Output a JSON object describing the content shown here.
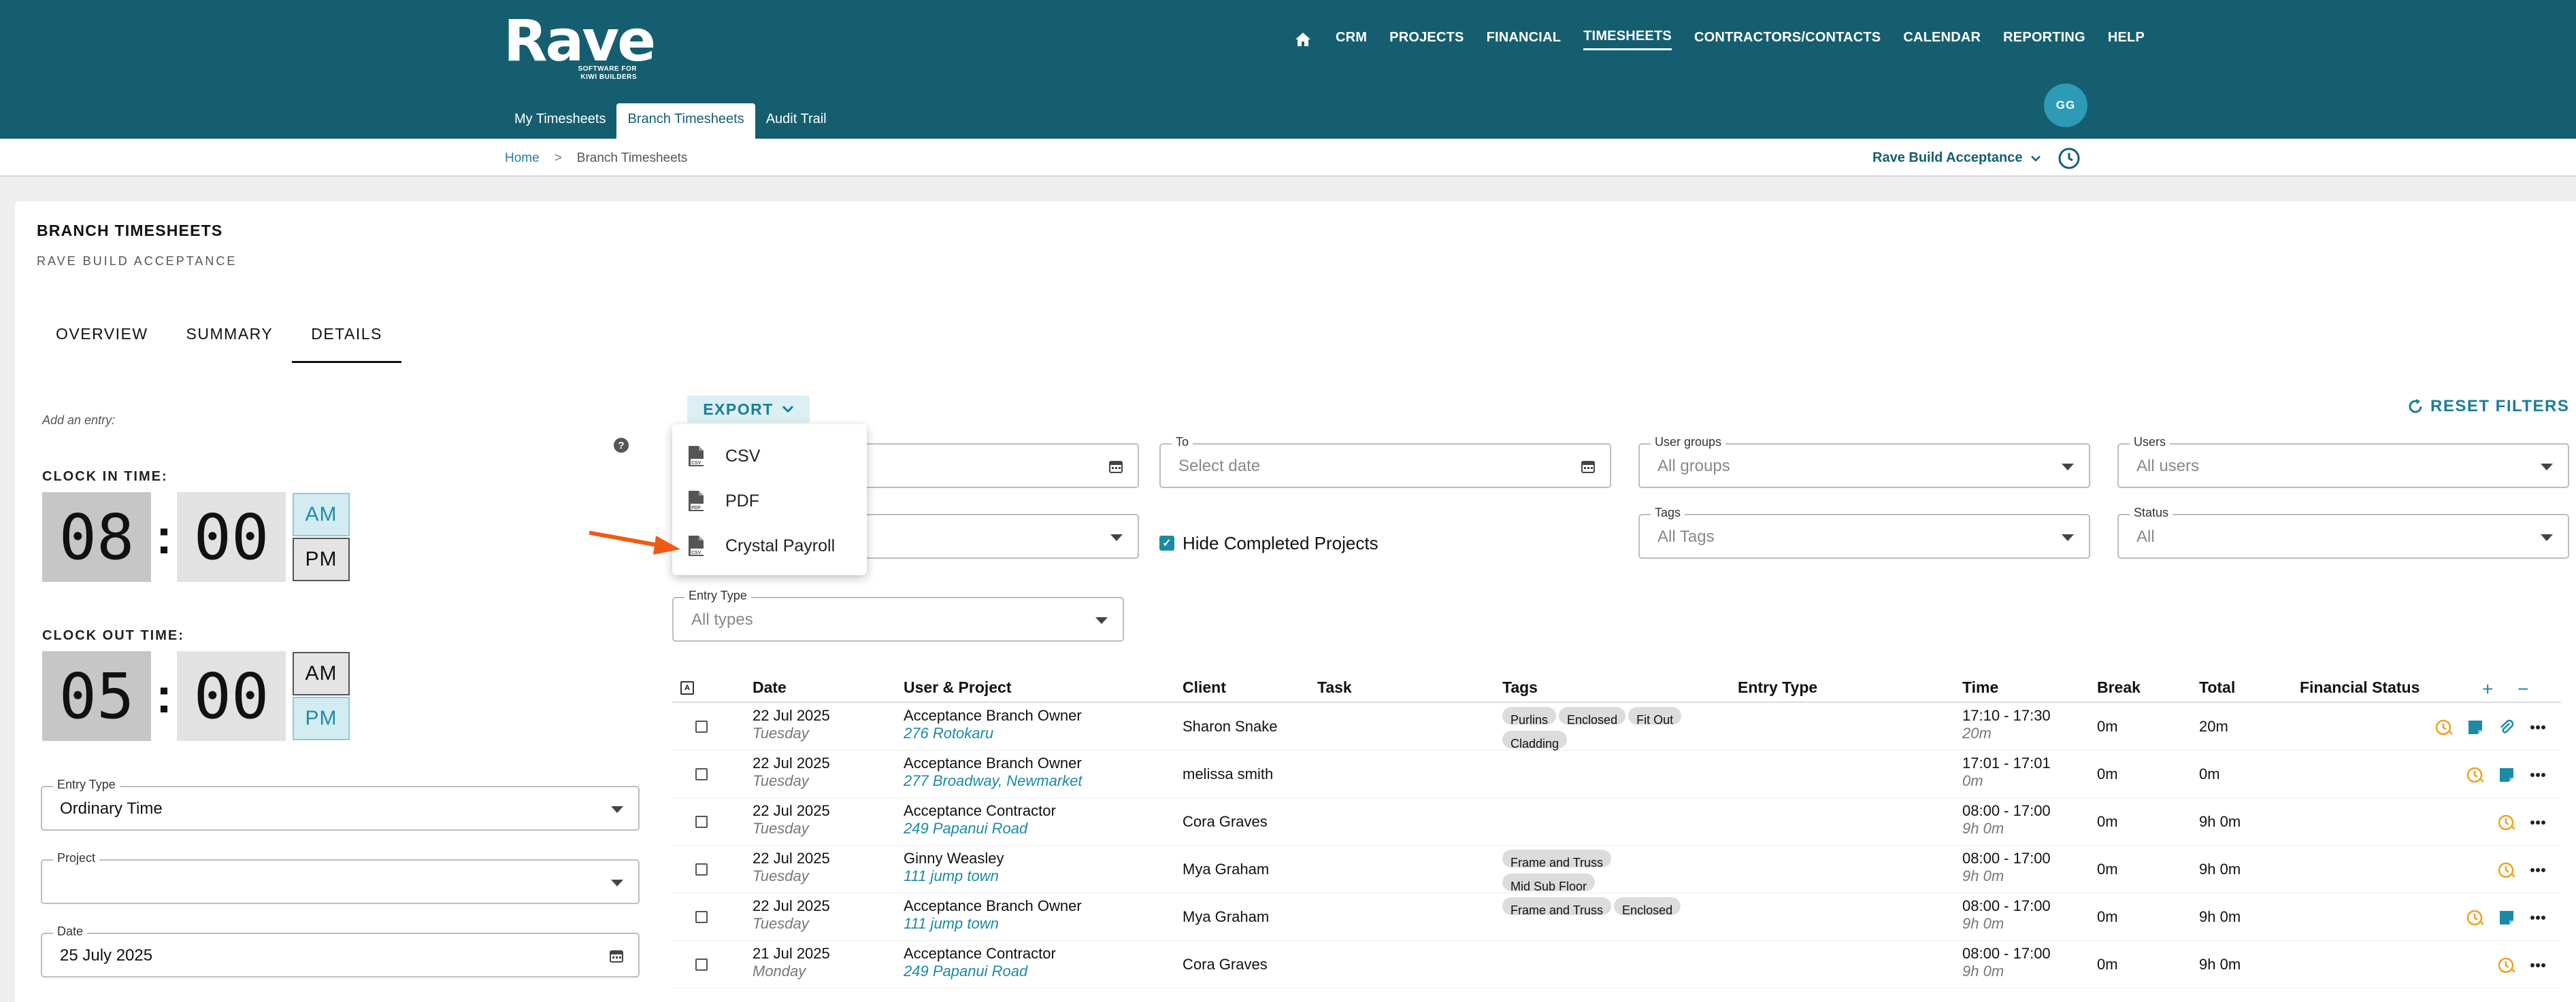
{
  "app": {
    "logo_text": "Rave",
    "logo_subtext": "SOFTWARE FOR KIWI BUILDERS",
    "nav": [
      "CRM",
      "PROJECTS",
      "FINANCIAL",
      "TIMESHEETS",
      "CONTRACTORS/CONTACTS",
      "CALENDAR",
      "REPORTING",
      "HELP"
    ],
    "nav_active": "TIMESHEETS",
    "subtabs": [
      "My Timesheets",
      "Branch Timesheets",
      "Audit Trail"
    ],
    "avatar": "GG"
  },
  "breadcrumb": {
    "home": "Home",
    "sep": ">",
    "current": "Branch Timesheets"
  },
  "company": "Rave Build Acceptance",
  "page": {
    "title": "BRANCH TIMESHEETS",
    "subtitle": "RAVE BUILD ACCEPTANCE",
    "tabs": [
      "OVERVIEW",
      "SUMMARY",
      "DETAILS"
    ]
  },
  "entry": {
    "add_label": "Add an entry:",
    "help": "?",
    "clock_in_label": "CLOCK IN TIME:",
    "clock_in_hour": "08",
    "clock_in_min": "00",
    "clock_out_label": "CLOCK OUT TIME:",
    "clock_out_hour": "05",
    "clock_out_min": "00",
    "colon": ":",
    "am": "AM",
    "pm": "PM",
    "entry_type_label": "Entry Type",
    "entry_type_value": "Ordinary Time",
    "project_label": "Project",
    "date_label": "Date",
    "date_value": "25 July 2025"
  },
  "toolbar": {
    "export_label": "EXPORT",
    "reset_label": "RESET FILTERS",
    "export_menu": [
      "CSV",
      "PDF",
      "Crystal Payroll"
    ],
    "file_icon_tags": [
      "CSV",
      "PDF",
      "CSV"
    ]
  },
  "filters": {
    "to_label": "To",
    "to_placeholder": "Select date",
    "groups_label": "User groups",
    "groups_placeholder": "All groups",
    "users_label": "Users",
    "users_placeholder": "All users",
    "hide_completed": "Hide Completed Projects",
    "tags_label": "Tags",
    "tags_placeholder": "All Tags",
    "status_label": "Status",
    "status_placeholder": "All",
    "entry_type_label": "Entry Type",
    "entry_type_placeholder": "All types"
  },
  "table": {
    "columns": [
      "Date",
      "User & Project",
      "Client",
      "Task",
      "Tags",
      "Entry Type",
      "Time",
      "Break",
      "Total",
      "Financial Status"
    ],
    "select_all_mark": "A",
    "plus": "+",
    "minus": "−",
    "rows": [
      {
        "date": "22 Jul 2025",
        "day": "Tuesday",
        "user": "Acceptance Branch Owner",
        "project": "276 Rotokaru",
        "client": "Sharon Snake",
        "tags": [
          "Purlins",
          "Enclosed",
          "Fit Out",
          "Cladding"
        ],
        "time": "17:10 - 17:30",
        "dur": "20m",
        "break": "0m",
        "total": "20m",
        "icons": [
          "clock-icon",
          "note-icon",
          "attachment-icon",
          "more-icon"
        ]
      },
      {
        "date": "22 Jul 2025",
        "day": "Tuesday",
        "user": "Acceptance Branch Owner",
        "project": "277 Broadway, Newmarket",
        "client": "melissa smith",
        "tags": [],
        "time": "17:01 - 17:01",
        "dur": "0m",
        "break": "0m",
        "total": "0m",
        "icons": [
          "clock-icon",
          "note-icon",
          "more-icon"
        ]
      },
      {
        "date": "22 Jul 2025",
        "day": "Tuesday",
        "user": "Acceptance Contractor",
        "project": "249 Papanui Road",
        "client": "Cora Graves",
        "tags": [],
        "time": "08:00 - 17:00",
        "dur": "9h 0m",
        "break": "0m",
        "total": "9h 0m",
        "icons": [
          "clock-icon",
          "more-icon"
        ]
      },
      {
        "date": "22 Jul 2025",
        "day": "Tuesday",
        "user": "Ginny Weasley",
        "project": "111 jump town",
        "client": "Mya Graham",
        "tags": [
          "Frame and Truss",
          "Mid Sub Floor"
        ],
        "time": "08:00 - 17:00",
        "dur": "9h 0m",
        "break": "0m",
        "total": "9h 0m",
        "icons": [
          "clock-icon",
          "more-icon"
        ]
      },
      {
        "date": "22 Jul 2025",
        "day": "Tuesday",
        "user": "Acceptance Branch Owner",
        "project": "111 jump town",
        "client": "Mya Graham",
        "tags": [
          "Frame and Truss",
          "Enclosed"
        ],
        "time": "08:00 - 17:00",
        "dur": "9h 0m",
        "break": "0m",
        "total": "9h 0m",
        "icons": [
          "clock-icon",
          "note-icon",
          "more-icon"
        ]
      },
      {
        "date": "21 Jul 2025",
        "day": "Monday",
        "user": "Acceptance Contractor",
        "project": "249 Papanui Road",
        "client": "Cora Graves",
        "tags": [],
        "time": "08:00 - 17:00",
        "dur": "9h 0m",
        "break": "0m",
        "total": "9h 0m",
        "icons": [
          "clock-icon",
          "more-icon"
        ]
      }
    ]
  },
  "colors": {
    "header": "#155e70",
    "accent": "#1a8aa6",
    "orange": "#f05a14"
  }
}
